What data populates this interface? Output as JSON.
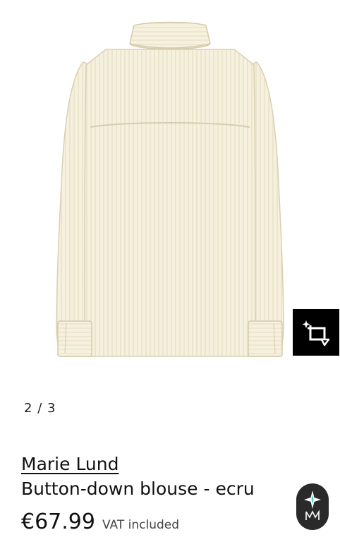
{
  "gallery": {
    "current": "2",
    "separator": "/",
    "total": "3"
  },
  "product": {
    "brand": "Marie Lund",
    "name": "Button-down blouse - ecru",
    "price": "€67.99",
    "vat_note": "VAT included",
    "garment_color": "#f5f0dc"
  },
  "icons": {
    "image_action": "crop-frame-sparkle-icon",
    "assistant": "sparkle-assistant-icon"
  }
}
